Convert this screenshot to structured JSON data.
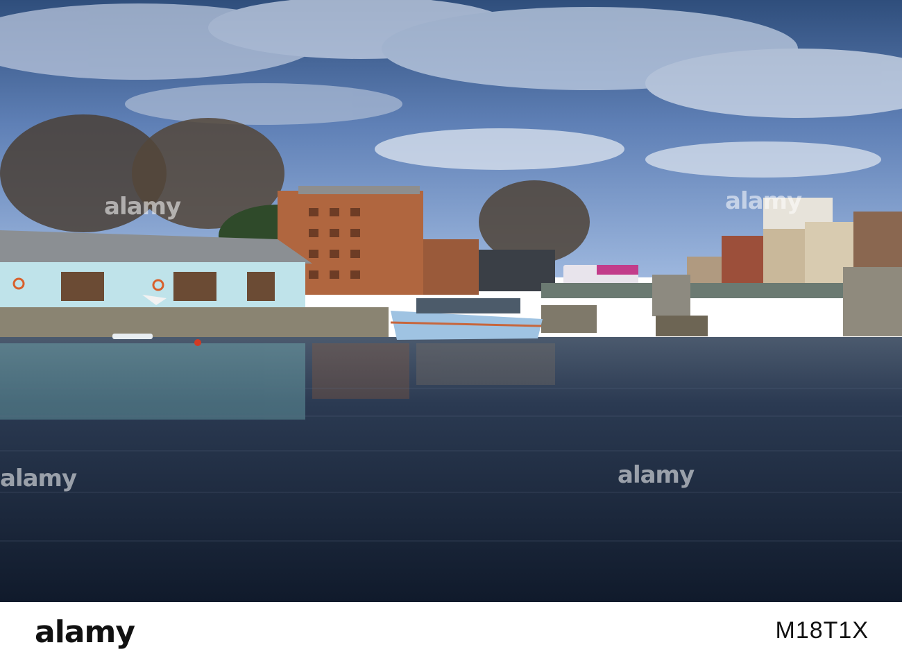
{
  "photo": {
    "watermark_text": "alamy",
    "scene": "harbour"
  },
  "footer": {
    "brand": "alamy",
    "image_id": "M18T1X"
  },
  "colors": {
    "sky_top": "#3d5f8e",
    "sky_mid": "#6f8fbf",
    "water_dark": "#1b2a40",
    "building_blue": "#bfe3ea",
    "brick": "#b0663f"
  }
}
